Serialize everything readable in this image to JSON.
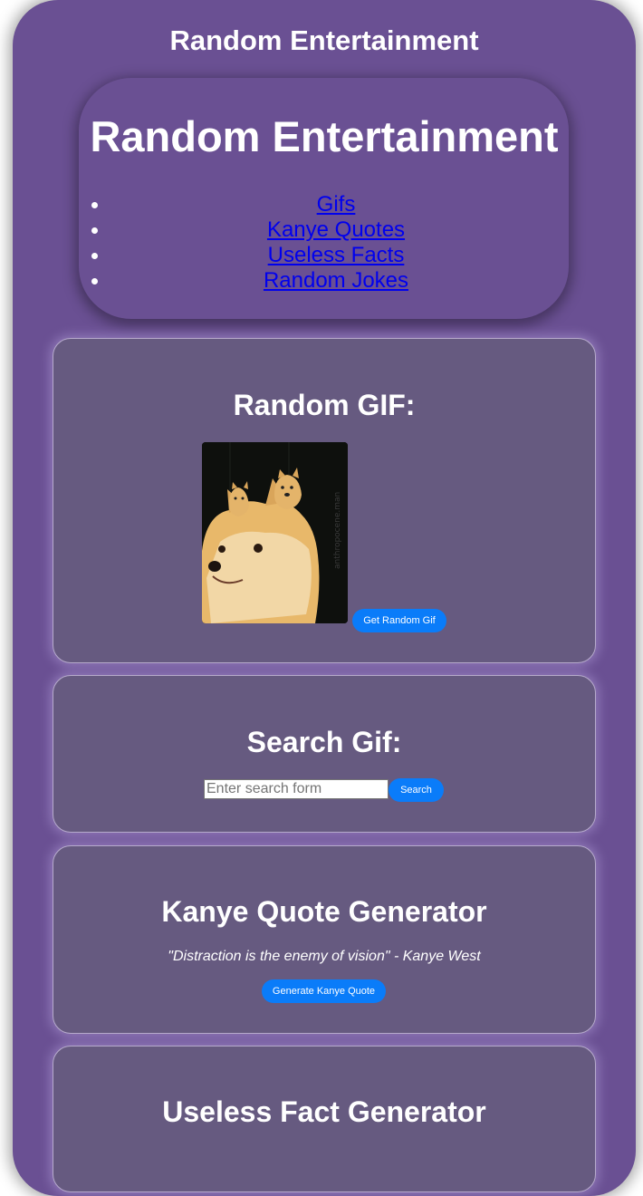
{
  "page": {
    "title": "Random Entertainment"
  },
  "header": {
    "title": "Random Entertainment",
    "nav": [
      {
        "label": "Gifs"
      },
      {
        "label": "Kanye Quotes"
      },
      {
        "label": "Useless Facts"
      },
      {
        "label": "Random Jokes"
      }
    ]
  },
  "random_gif": {
    "heading": "Random GIF:",
    "button_label": "Get Random Gif",
    "image_description_icon": "doge-gif-image",
    "watermark": "anthropocene.man"
  },
  "search_gif": {
    "heading": "Search Gif:",
    "placeholder": "Enter search form",
    "button_label": "Search"
  },
  "kanye": {
    "heading": "Kanye Quote Generator",
    "quote": "\"Distraction is the enemy of vision\" - Kanye West",
    "button_label": "Generate Kanye Quote"
  },
  "useless_fact": {
    "heading": "Useless Fact Generator"
  },
  "colors": {
    "background": "#6a5093",
    "card": "#665a80",
    "button": "#0a7cf9",
    "link": "#0000ee"
  }
}
